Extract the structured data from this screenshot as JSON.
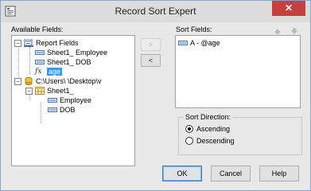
{
  "window": {
    "title": "Record Sort Expert",
    "close_label": "✕"
  },
  "available": {
    "label": "Available Fields:",
    "items": [
      {
        "label": "Report Fields",
        "icon": "report-icon",
        "expander": "−"
      },
      {
        "label": "Sheet1_ Employee",
        "icon": "field-icon"
      },
      {
        "label": "Sheet1_ DOB",
        "icon": "field-icon"
      },
      {
        "label": "age",
        "icon": "formula-icon",
        "selected": true
      },
      {
        "label": "C:\\Users\\                \\Desktop\\v",
        "icon": "database-icon",
        "expander": "−"
      },
      {
        "label": "Sheet1_",
        "icon": "table-icon",
        "expander": "−"
      },
      {
        "label": "Employee",
        "icon": "field-icon"
      },
      {
        "label": "DOB",
        "icon": "field-icon"
      }
    ]
  },
  "move": {
    "add_label": ">",
    "remove_label": "<"
  },
  "sort": {
    "label": "Sort Fields:",
    "items": [
      {
        "label": "A - @age",
        "icon": "field-icon"
      }
    ]
  },
  "direction": {
    "label": "Sort Direction:",
    "ascending": "Ascending",
    "descending": "Descending",
    "selected": "Ascending"
  },
  "buttons": {
    "ok": "OK",
    "cancel": "Cancel",
    "help": "Help"
  },
  "colors": {
    "selection": "#3399ff",
    "close": "#c7413c"
  }
}
